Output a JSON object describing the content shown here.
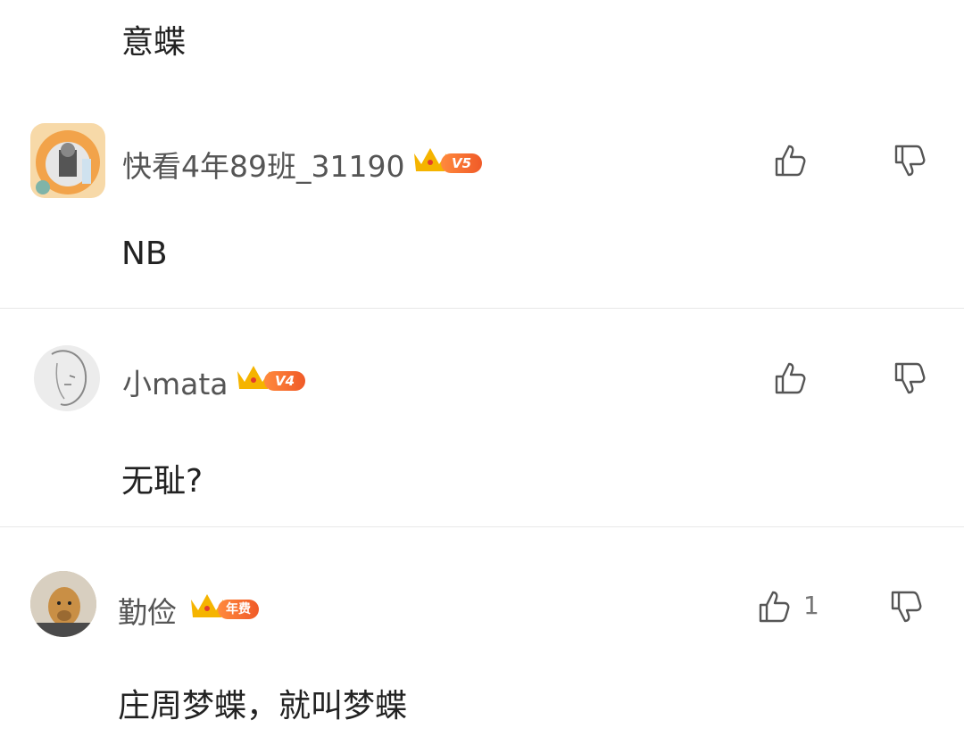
{
  "top_snippet": "意蝶",
  "colors": {
    "badge": "#f05a28",
    "crown": "#f5b400",
    "divider": "#e8e8e8"
  },
  "comments": [
    {
      "username": "快看4年89班_31190",
      "badge": "V5",
      "avatar": "pumpkin-frame-avatar",
      "like_count": "",
      "content": "NB"
    },
    {
      "username": "小mata",
      "badge": "V4",
      "avatar": "sketch-portrait-avatar",
      "like_count": "",
      "content": "无耻?"
    },
    {
      "username": "勤俭",
      "badge": "年费",
      "avatar": "dog-photo-avatar",
      "like_count": "1",
      "content": "庄周梦蝶，就叫梦蝶"
    }
  ]
}
